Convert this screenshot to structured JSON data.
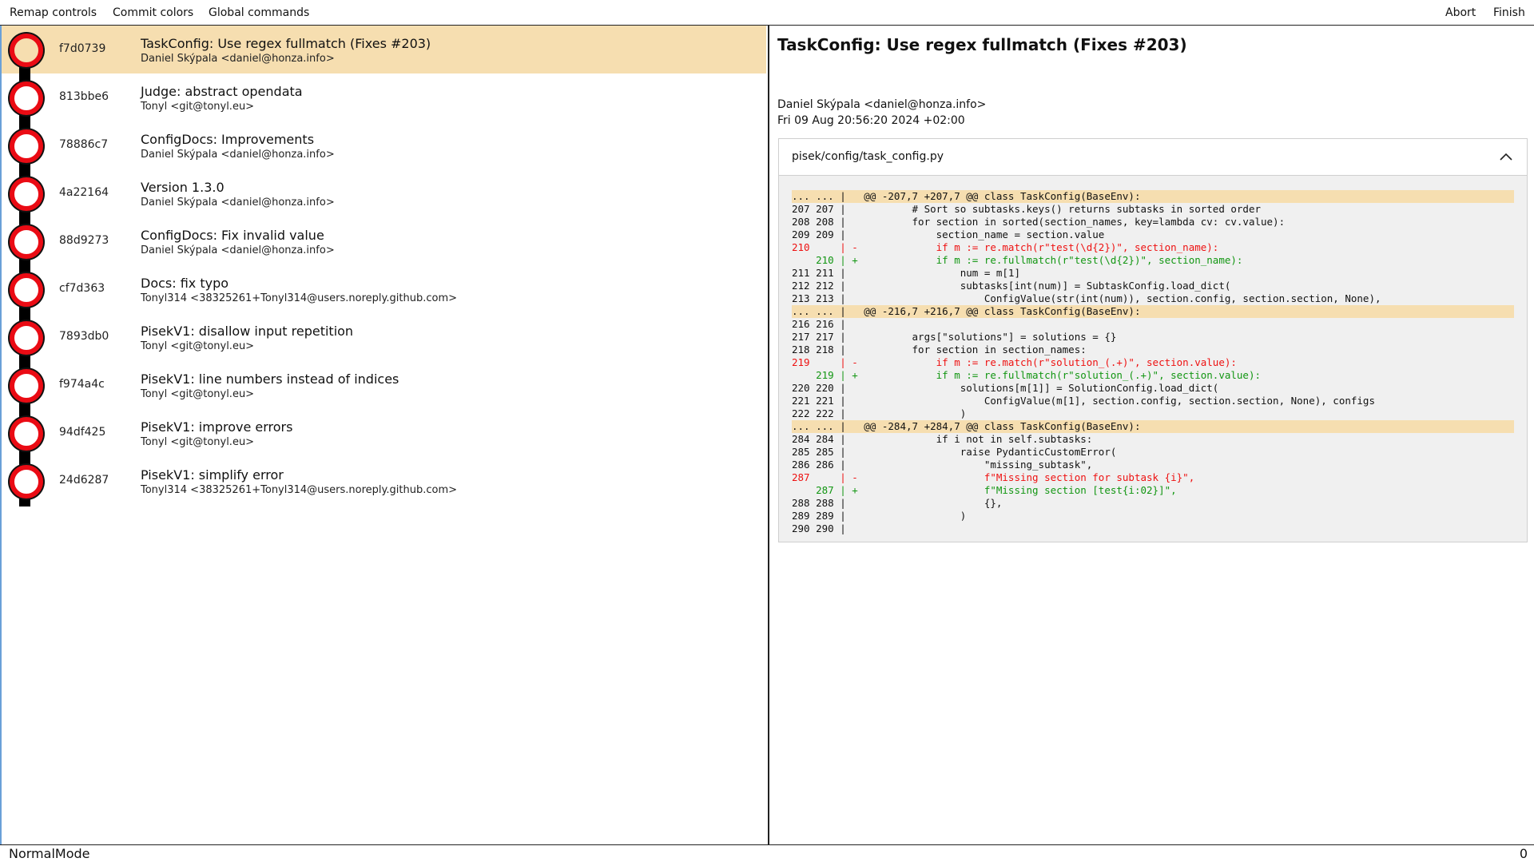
{
  "menu": {
    "left": [
      "Remap controls",
      "Commit colors",
      "Global commands"
    ],
    "right": [
      "Abort",
      "Finish"
    ]
  },
  "commits": [
    {
      "hash": "f7d0739",
      "subject": "TaskConfig: Use regex fullmatch (Fixes #203)",
      "author": "Daniel Skýpala <daniel@honza.info>",
      "selected": true
    },
    {
      "hash": "813bbe6",
      "subject": "Judge: abstract opendata",
      "author": "Tonyl <git@tonyl.eu>"
    },
    {
      "hash": "78886c7",
      "subject": "ConfigDocs: Improvements",
      "author": "Daniel Skýpala <daniel@honza.info>"
    },
    {
      "hash": "4a22164",
      "subject": "Version 1.3.0",
      "author": "Daniel Skýpala <daniel@honza.info>"
    },
    {
      "hash": "88d9273",
      "subject": "ConfigDocs: Fix invalid value",
      "author": "Daniel Skýpala <daniel@honza.info>"
    },
    {
      "hash": "cf7d363",
      "subject": "Docs: fix typo",
      "author": "Tonyl314 <38325261+Tonyl314@users.noreply.github.com>"
    },
    {
      "hash": "7893db0",
      "subject": "PisekV1: disallow input repetition",
      "author": "Tonyl <git@tonyl.eu>"
    },
    {
      "hash": "f974a4c",
      "subject": "PisekV1: line numbers instead of indices",
      "author": "Tonyl <git@tonyl.eu>"
    },
    {
      "hash": "94df425",
      "subject": "PisekV1: improve errors",
      "author": "Tonyl <git@tonyl.eu>"
    },
    {
      "hash": "24d6287",
      "subject": "PisekV1: simplify error",
      "author": "Tonyl314 <38325261+Tonyl314@users.noreply.github.com>"
    }
  ],
  "detail": {
    "title": "TaskConfig: Use regex fullmatch (Fixes #203)",
    "author": "Daniel Skýpala <daniel@honza.info>",
    "date": "Fri 09 Aug 20:56:20 2024 +02:00",
    "file": {
      "name": "pisek/config/task_config.py",
      "diff": [
        {
          "type": "hunk",
          "text": "... ... |   @@ -207,7 +207,7 @@ class TaskConfig(BaseEnv):"
        },
        {
          "type": "ctx",
          "text": "207 207 |           # Sort so subtasks.keys() returns subtasks in sorted order"
        },
        {
          "type": "ctx",
          "text": "208 208 |           for section in sorted(section_names, key=lambda cv: cv.value):"
        },
        {
          "type": "ctx",
          "text": "209 209 |               section_name = section.value"
        },
        {
          "type": "del",
          "text": "210     | -             if m := re.match(r\"test(\\d{2})\", section_name):"
        },
        {
          "type": "add",
          "text": "    210 | +             if m := re.fullmatch(r\"test(\\d{2})\", section_name):"
        },
        {
          "type": "ctx",
          "text": "211 211 |                   num = m[1]"
        },
        {
          "type": "ctx",
          "text": "212 212 |                   subtasks[int(num)] = SubtaskConfig.load_dict("
        },
        {
          "type": "ctx",
          "text": "213 213 |                       ConfigValue(str(int(num)), section.config, section.section, None),"
        },
        {
          "type": "hunk",
          "text": "... ... |   @@ -216,7 +216,7 @@ class TaskConfig(BaseEnv):"
        },
        {
          "type": "ctx",
          "text": "216 216 |"
        },
        {
          "type": "ctx",
          "text": "217 217 |           args[\"solutions\"] = solutions = {}"
        },
        {
          "type": "ctx",
          "text": "218 218 |           for section in section_names:"
        },
        {
          "type": "del",
          "text": "219     | -             if m := re.match(r\"solution_(.+)\", section.value):"
        },
        {
          "type": "add",
          "text": "    219 | +             if m := re.fullmatch(r\"solution_(.+)\", section.value):"
        },
        {
          "type": "ctx",
          "text": "220 220 |                   solutions[m[1]] = SolutionConfig.load_dict("
        },
        {
          "type": "ctx",
          "text": "221 221 |                       ConfigValue(m[1], section.config, section.section, None), configs"
        },
        {
          "type": "ctx",
          "text": "222 222 |                   )"
        },
        {
          "type": "hunk",
          "text": "... ... |   @@ -284,7 +284,7 @@ class TaskConfig(BaseEnv):"
        },
        {
          "type": "ctx",
          "text": "284 284 |               if i not in self.subtasks:"
        },
        {
          "type": "ctx",
          "text": "285 285 |                   raise PydanticCustomError("
        },
        {
          "type": "ctx",
          "text": "286 286 |                       \"missing_subtask\","
        },
        {
          "type": "del",
          "text": "287     | -                     f\"Missing section for subtask {i}\","
        },
        {
          "type": "add",
          "text": "    287 | +                     f\"Missing section [test{i:02}]\","
        },
        {
          "type": "ctx",
          "text": "288 288 |                       {},"
        },
        {
          "type": "ctx",
          "text": "289 289 |                   )"
        },
        {
          "type": "ctx",
          "text": "290 290 |"
        }
      ]
    }
  },
  "status": {
    "mode": "NormalMode",
    "count": "0"
  },
  "colors": {
    "selected": "#f6deb0",
    "node": "#ea0b14",
    "deleted": "#e11111",
    "added": "#129612",
    "hunk": "#f6deb0"
  },
  "icons": {
    "collapse": "chevron-up-icon",
    "commit_node": "commit-node-icon"
  }
}
